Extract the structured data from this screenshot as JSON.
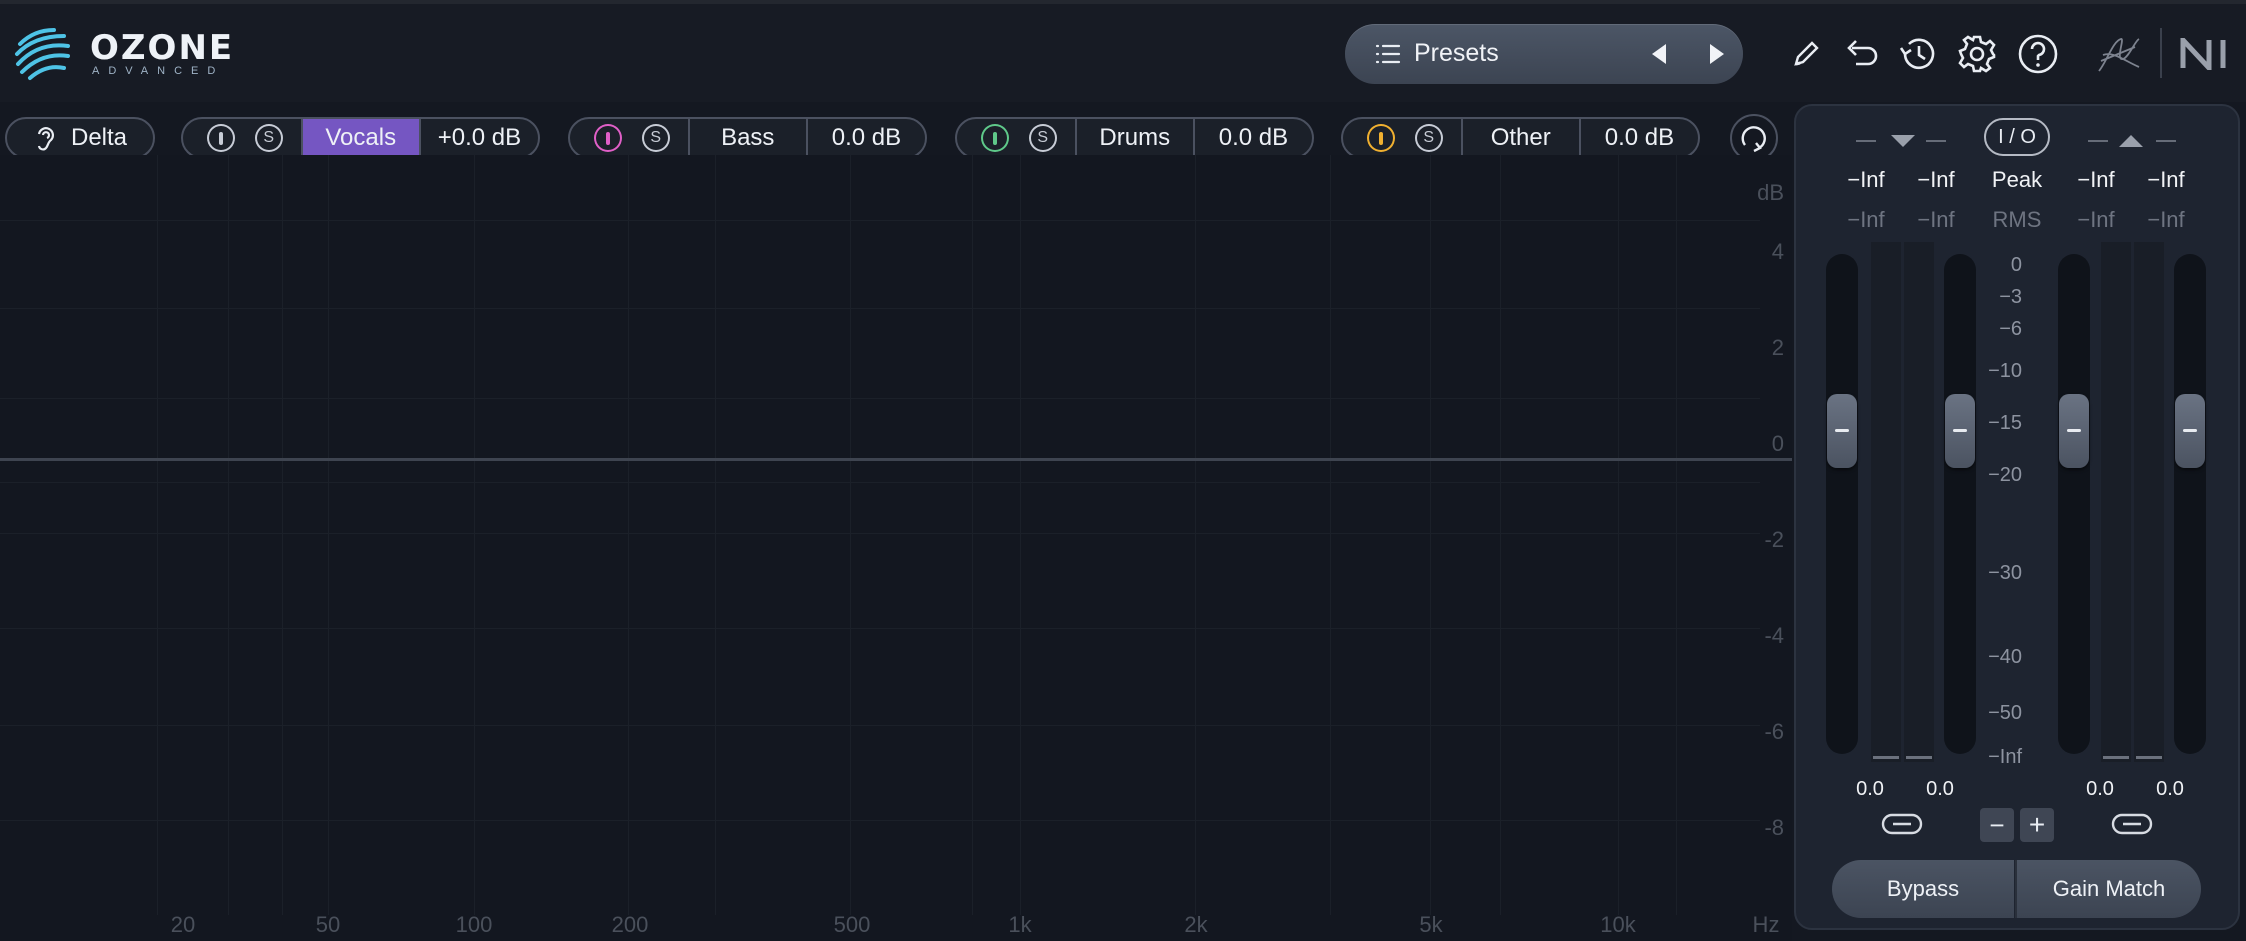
{
  "app": {
    "logo_title": "OZONE",
    "logo_subtitle": "ADVANCED"
  },
  "header": {
    "presets_label": "Presets",
    "icons": [
      "presets-list-icon",
      "previous-preset-icon",
      "next-preset-icon",
      "pencil-icon",
      "undo-icon",
      "history-icon",
      "settings-gear-icon",
      "help-icon",
      "signature-icon",
      "ni-logo-icon"
    ]
  },
  "modules": {
    "delta_label": "Delta",
    "stems": [
      {
        "name": "Vocals",
        "gain": "+0.0 dB",
        "color": "#8c5cd6",
        "active": true
      },
      {
        "name": "Bass",
        "gain": "0.0 dB",
        "color": "#e05fc7",
        "active": false
      },
      {
        "name": "Drums",
        "gain": "0.0 dB",
        "color": "#5fc98a",
        "active": false
      },
      {
        "name": "Other",
        "gain": "0.0 dB",
        "color": "#f0b030",
        "active": false
      }
    ],
    "solo_glyph": "S"
  },
  "eq": {
    "db_unit": "dB",
    "db_ticks": [
      "4",
      "2",
      "0",
      "-2",
      "-4",
      "-6",
      "-8"
    ],
    "hz_unit": "Hz",
    "hz_ticks": [
      "20",
      "50",
      "100",
      "200",
      "500",
      "1k",
      "2k",
      "5k",
      "10k"
    ]
  },
  "meters": {
    "io_label": "I / O",
    "peak_label": "Peak",
    "rms_label": "RMS",
    "input_peak": [
      "−Inf",
      "−Inf"
    ],
    "input_rms": [
      "−Inf",
      "−Inf"
    ],
    "output_peak": [
      "−Inf",
      "−Inf"
    ],
    "output_rms": [
      "−Inf",
      "−Inf"
    ],
    "scale": [
      "0",
      "−3",
      "−6",
      "−10",
      "−15",
      "−20",
      "−30",
      "−40",
      "−50",
      "−Inf"
    ],
    "input_gain": [
      "0.0",
      "0.0"
    ],
    "output_gain": [
      "0.0",
      "0.0"
    ],
    "minus_glyph": "−",
    "plus_glyph": "+",
    "bypass_label": "Bypass",
    "gain_match_label": "Gain Match"
  }
}
